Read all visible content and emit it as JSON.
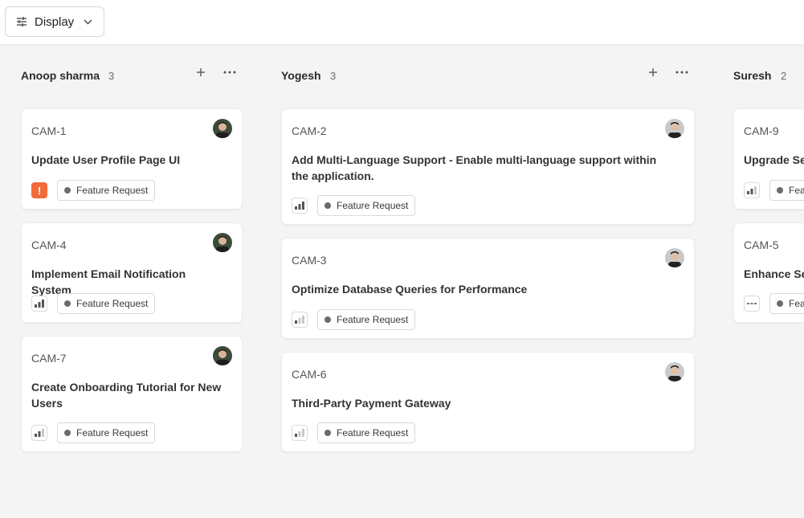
{
  "toolbar": {
    "display_label": "Display"
  },
  "columns": [
    {
      "name": "Anoop sharma",
      "count": "3",
      "cards": [
        {
          "id": "CAM-1",
          "title": "Update User Profile Page UI",
          "priority": "urgent-icon",
          "tag": "Feature Request"
        },
        {
          "id": "CAM-4",
          "title": "Implement Email Notification System",
          "priority": "priority-high-icon",
          "tag": "Feature Request"
        },
        {
          "id": "CAM-7",
          "title": "Create Onboarding Tutorial for New Users",
          "priority": "priority-medium-icon",
          "tag": "Feature Request"
        }
      ]
    },
    {
      "name": "Yogesh",
      "count": "3",
      "cards": [
        {
          "id": "CAM-2",
          "title": "Add Multi-Language Support - Enable multi-language support within the application.",
          "priority": "priority-high-icon",
          "tag": "Feature Request"
        },
        {
          "id": "CAM-3",
          "title": "Optimize Database Queries for Performance",
          "priority": "priority-low-icon",
          "tag": "Feature Request"
        },
        {
          "id": "CAM-6",
          "title": "Third-Party Payment Gateway",
          "priority": "priority-low-icon",
          "tag": "Feature Request"
        }
      ]
    },
    {
      "name": "Suresh",
      "count": "2",
      "cards": [
        {
          "id": "CAM-9",
          "title": "Upgrade Server Infrastructure",
          "priority": "priority-medium-icon",
          "tag": "Feature Request"
        },
        {
          "id": "CAM-5",
          "title": "Enhance Search Functionality",
          "priority": "no-priority-icon",
          "tag": "Feature Request"
        }
      ]
    }
  ],
  "colors": {
    "urgent": "#f26b3a",
    "background": "#f4f4f5",
    "card": "#ffffff"
  }
}
